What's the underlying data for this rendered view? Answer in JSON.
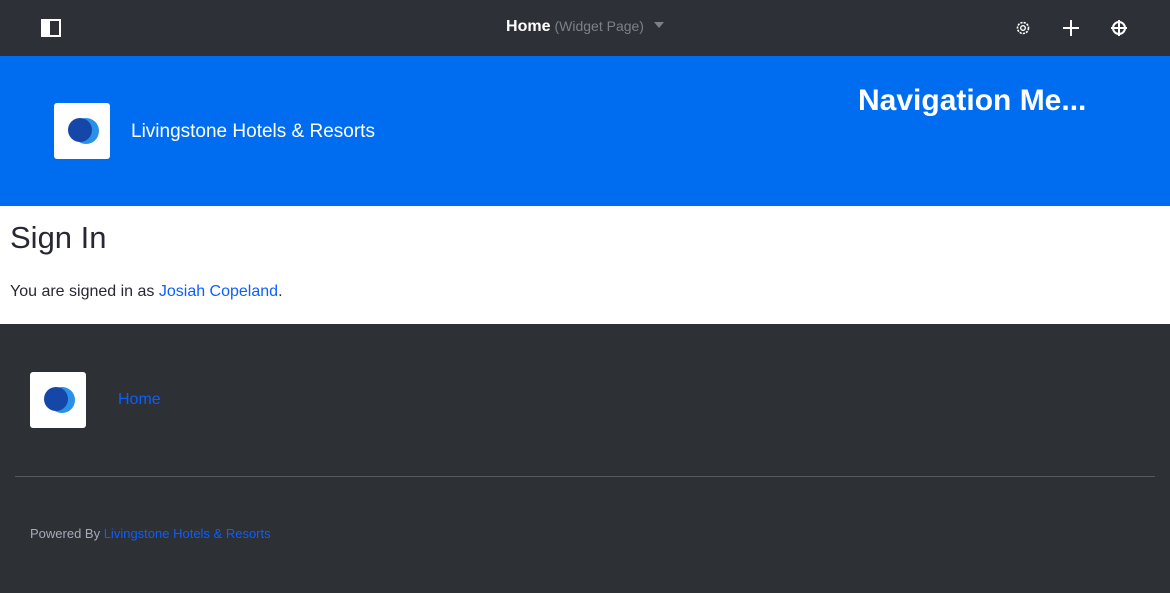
{
  "topbar": {
    "page_title": "Home",
    "page_type": "(Widget Page)",
    "icons": [
      "sidebar-panel-icon",
      "gear-icon",
      "plus-icon",
      "target-icon"
    ]
  },
  "header": {
    "site_name": "Livingstone Hotels & Resorts",
    "navigation_menu": "Navigation Me..."
  },
  "content": {
    "heading": "Sign In",
    "signed_prefix": "You are signed in as ",
    "user_name": "Josiah Copeland",
    "signed_suffix": "."
  },
  "footer": {
    "home_link": "Home",
    "powered_prefix": "Powered By ",
    "powered_link": "Livingstone Hotels & Resorts"
  },
  "colors": {
    "topbar_bg": "#2d3036",
    "header_bg": "#006df0",
    "footer_bg": "#2d3034",
    "link": "#0b5fff",
    "logo_dark": "#1547a9",
    "logo_light": "#2b91e8"
  }
}
